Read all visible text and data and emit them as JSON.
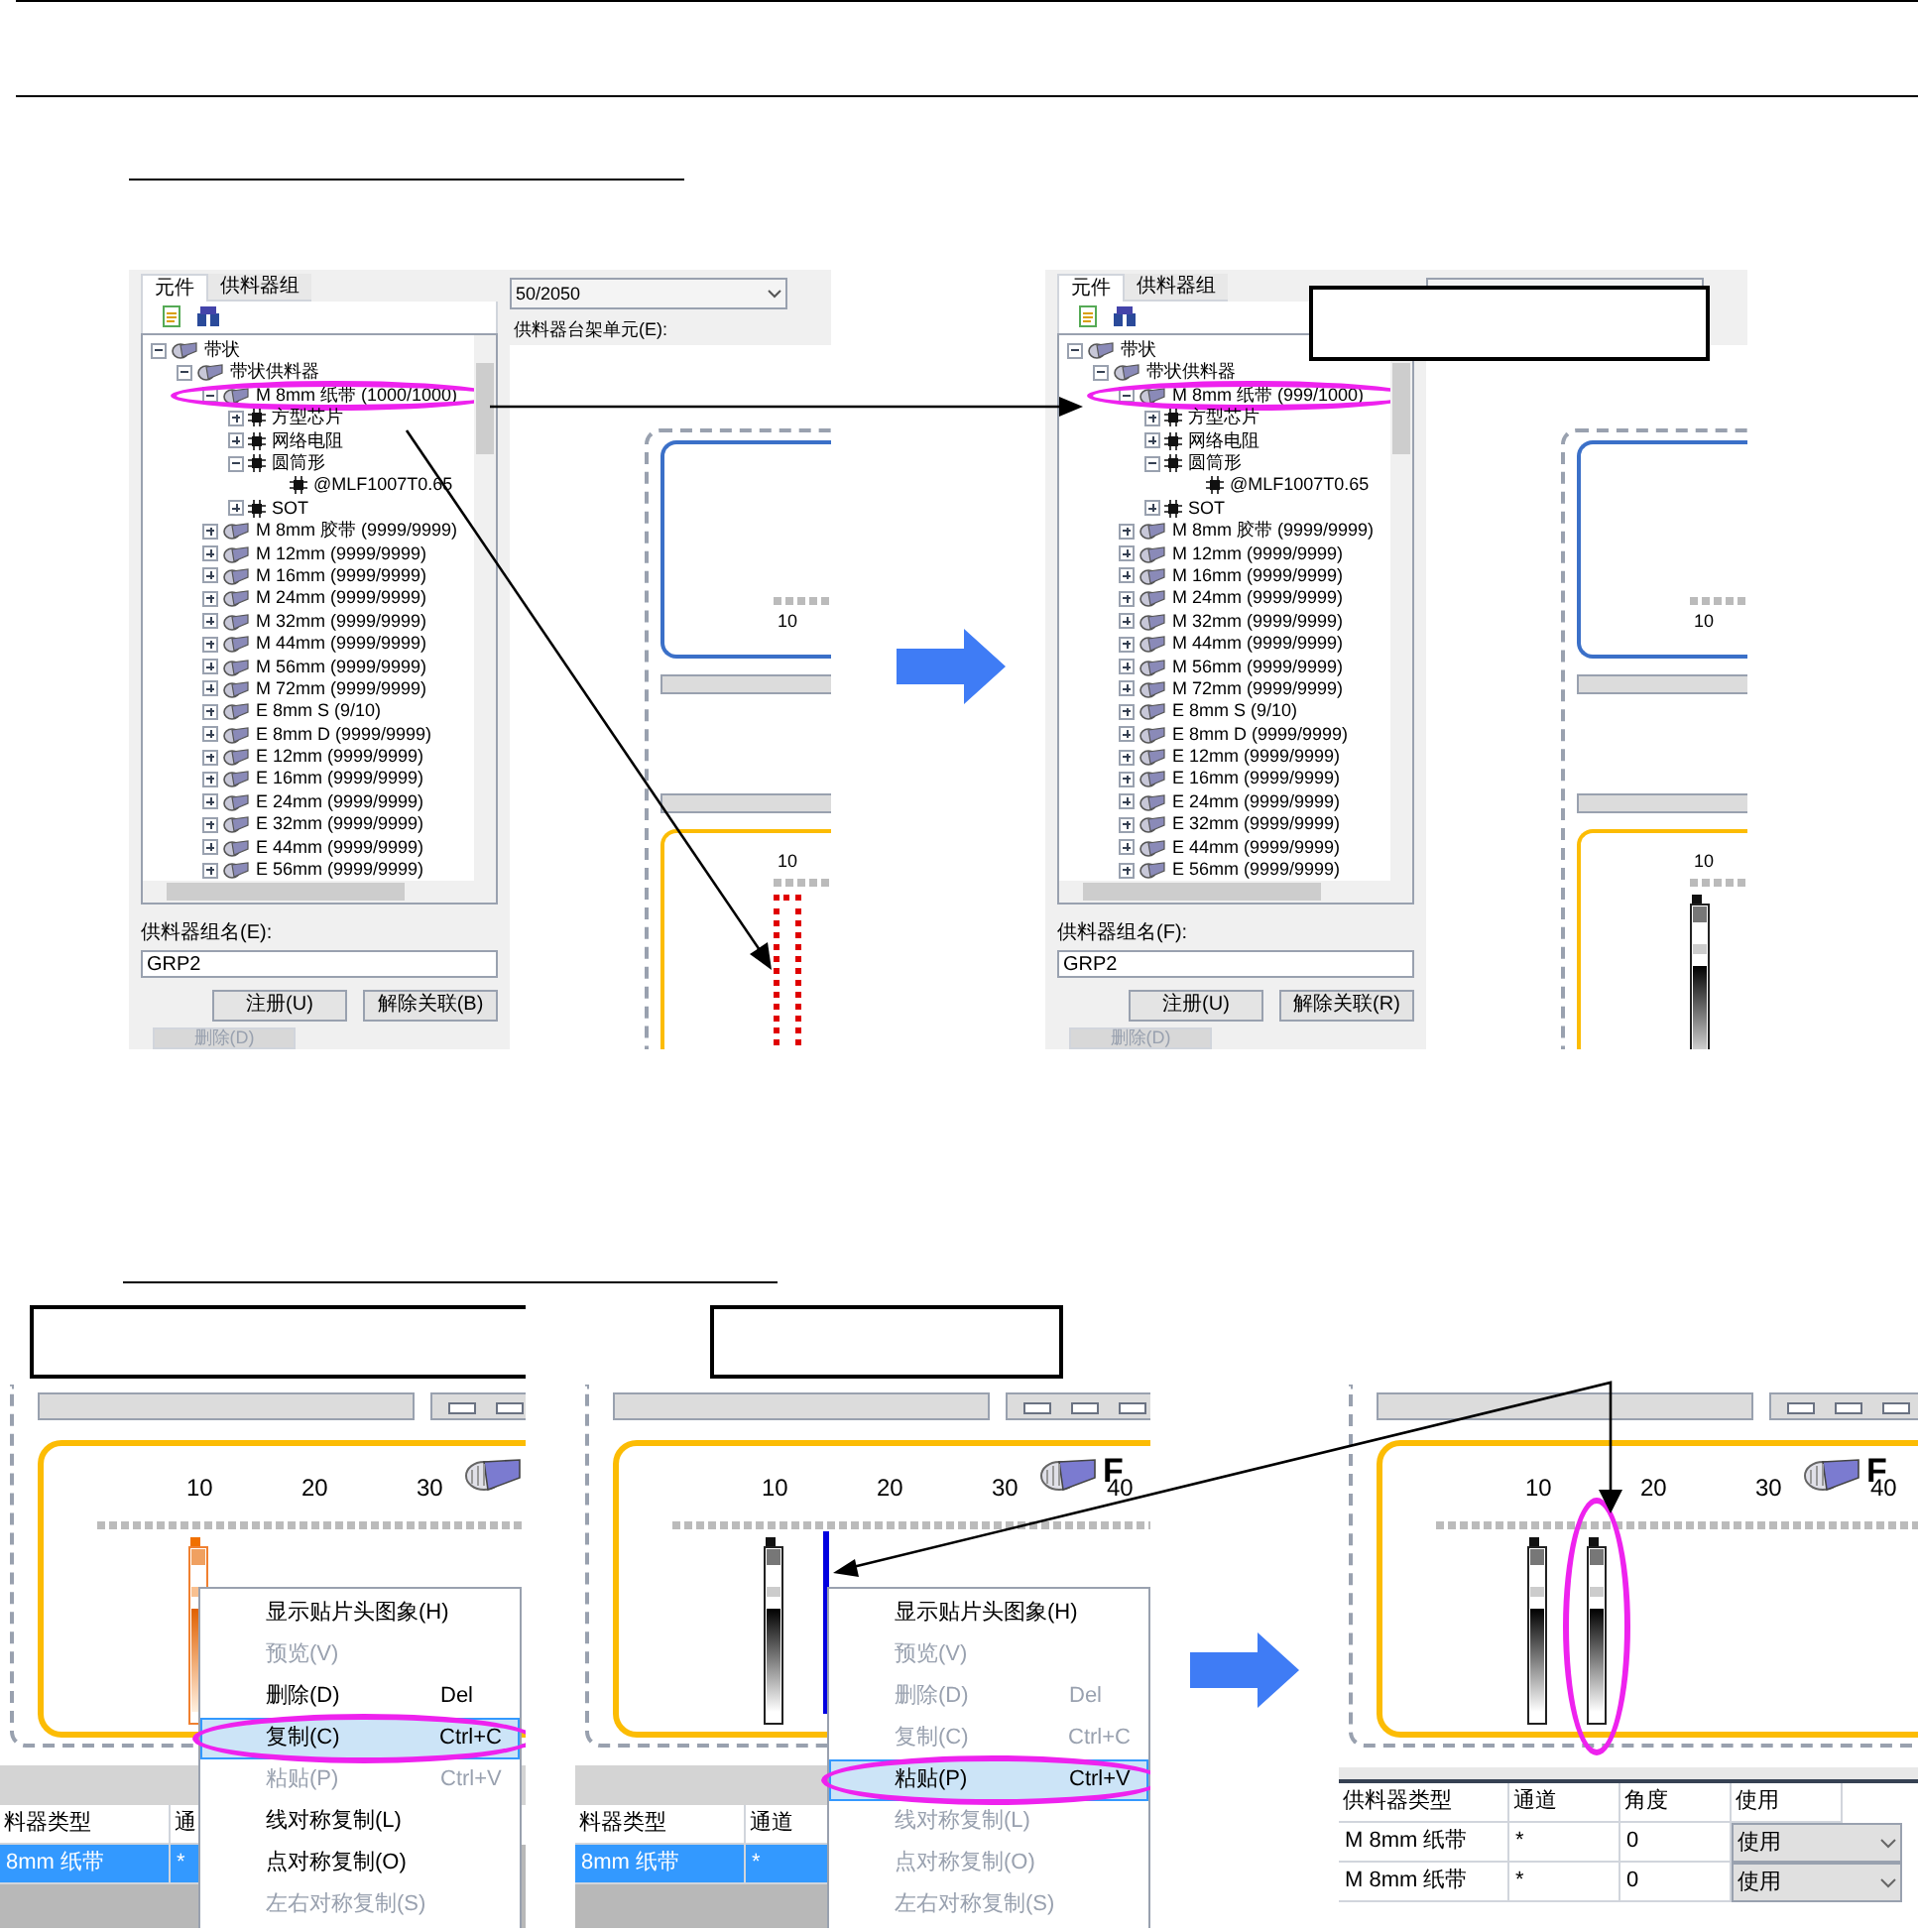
{
  "figure_1": {
    "panels": [
      {
        "tabs": [
          {
            "label": "元件",
            "selected": true
          },
          {
            "label": "供料器组",
            "selected": false
          }
        ],
        "dropdown": "50/2050",
        "rack_label": "供料器台架单元(E):",
        "tree": [
          {
            "label": "带状",
            "kind": "reel",
            "expanded": true,
            "children": [
              {
                "label": "带状供料器",
                "kind": "reel",
                "expanded": true,
                "children": [
                  {
                    "label": "M 8mm 纸带 (1000/1000)",
                    "kind": "reel",
                    "expanded": true,
                    "circled": true,
                    "children": [
                      {
                        "label": "方型芯片",
                        "kind": "chip",
                        "expanded": false
                      },
                      {
                        "label": "网络电阻",
                        "kind": "chip",
                        "expanded": false
                      },
                      {
                        "label": "圆筒形",
                        "kind": "chip",
                        "expanded": true,
                        "children": [
                          {
                            "label": "@MLF1007T0.65",
                            "kind": "chip"
                          }
                        ]
                      },
                      {
                        "label": "SOT",
                        "kind": "chip",
                        "expanded": false
                      }
                    ]
                  },
                  {
                    "label": "M 8mm 胶带 (9999/9999)",
                    "kind": "reel",
                    "expanded": false
                  },
                  {
                    "label": "M 12mm (9999/9999)",
                    "kind": "reel",
                    "expanded": false
                  },
                  {
                    "label": "M 16mm (9999/9999)",
                    "kind": "reel",
                    "expanded": false
                  },
                  {
                    "label": "M 24mm (9999/9999)",
                    "kind": "reel",
                    "expanded": false
                  },
                  {
                    "label": "M 32mm (9999/9999)",
                    "kind": "reel",
                    "expanded": false
                  },
                  {
                    "label": "M 44mm (9999/9999)",
                    "kind": "reel",
                    "expanded": false
                  },
                  {
                    "label": "M 56mm (9999/9999)",
                    "kind": "reel",
                    "expanded": false
                  },
                  {
                    "label": "M 72mm (9999/9999)",
                    "kind": "reel",
                    "expanded": false
                  },
                  {
                    "label": "E 8mm S (9/10)",
                    "kind": "reel",
                    "expanded": false
                  },
                  {
                    "label": "E 8mm D (9999/9999)",
                    "kind": "reel",
                    "expanded": false
                  },
                  {
                    "label": "E 12mm (9999/9999)",
                    "kind": "reel",
                    "expanded": false
                  },
                  {
                    "label": "E 16mm (9999/9999)",
                    "kind": "reel",
                    "expanded": false
                  },
                  {
                    "label": "E 24mm (9999/9999)",
                    "kind": "reel",
                    "expanded": false
                  },
                  {
                    "label": "E 32mm (9999/9999)",
                    "kind": "reel",
                    "expanded": false
                  },
                  {
                    "label": "E 44mm (9999/9999)",
                    "kind": "reel",
                    "expanded": false
                  },
                  {
                    "label": "E 56mm (9999/9999)",
                    "kind": "reel",
                    "expanded": false
                  }
                ]
              }
            ]
          }
        ],
        "group_label": "供料器组名(E):",
        "group_value": "GRP2",
        "buttons": [
          {
            "label": "注册(U)",
            "disabled": false
          },
          {
            "label": "解除关联(B)",
            "disabled": false
          },
          {
            "label": "删除(D)",
            "disabled": true
          }
        ],
        "upper_ruler": [
          "10"
        ],
        "lower_ruler": [
          "10"
        ],
        "slots": [
          {
            "kind": "empty-slot"
          }
        ]
      },
      {
        "tabs": [
          {
            "label": "元件",
            "selected": true
          },
          {
            "label": "供料器组",
            "selected": false
          }
        ],
        "callout": true,
        "tree": [
          {
            "label": "带状",
            "kind": "reel",
            "expanded": true,
            "children": [
              {
                "label": "带状供料器",
                "kind": "reel",
                "expanded": true,
                "children": [
                  {
                    "label": "M 8mm 纸带 (999/1000)",
                    "kind": "reel",
                    "expanded": true,
                    "circled": true,
                    "children": [
                      {
                        "label": "方型芯片",
                        "kind": "chip",
                        "expanded": false
                      },
                      {
                        "label": "网络电阻",
                        "kind": "chip",
                        "expanded": false
                      },
                      {
                        "label": "圆筒形",
                        "kind": "chip",
                        "expanded": true,
                        "children": [
                          {
                            "label": "@MLF1007T0.65",
                            "kind": "chip"
                          }
                        ]
                      },
                      {
                        "label": "SOT",
                        "kind": "chip",
                        "expanded": false
                      }
                    ]
                  },
                  {
                    "label": "M 8mm 胶带 (9999/9999)",
                    "kind": "reel",
                    "expanded": false
                  },
                  {
                    "label": "M 12mm (9999/9999)",
                    "kind": "reel",
                    "expanded": false
                  },
                  {
                    "label": "M 16mm (9999/9999)",
                    "kind": "reel",
                    "expanded": false
                  },
                  {
                    "label": "M 24mm (9999/9999)",
                    "kind": "reel",
                    "expanded": false
                  },
                  {
                    "label": "M 32mm (9999/9999)",
                    "kind": "reel",
                    "expanded": false
                  },
                  {
                    "label": "M 44mm (9999/9999)",
                    "kind": "reel",
                    "expanded": false
                  },
                  {
                    "label": "M 56mm (9999/9999)",
                    "kind": "reel",
                    "expanded": false
                  },
                  {
                    "label": "M 72mm (9999/9999)",
                    "kind": "reel",
                    "expanded": false
                  },
                  {
                    "label": "E 8mm S (9/10)",
                    "kind": "reel",
                    "expanded": false
                  },
                  {
                    "label": "E 8mm D (9999/9999)",
                    "kind": "reel",
                    "expanded": false
                  },
                  {
                    "label": "E 12mm (9999/9999)",
                    "kind": "reel",
                    "expanded": false
                  },
                  {
                    "label": "E 16mm (9999/9999)",
                    "kind": "reel",
                    "expanded": false
                  },
                  {
                    "label": "E 24mm (9999/9999)",
                    "kind": "reel",
                    "expanded": false
                  },
                  {
                    "label": "E 32mm (9999/9999)",
                    "kind": "reel",
                    "expanded": false
                  },
                  {
                    "label": "E 44mm (9999/9999)",
                    "kind": "reel",
                    "expanded": false
                  },
                  {
                    "label": "E 56mm (9999/9999)",
                    "kind": "reel",
                    "expanded": false
                  }
                ]
              }
            ]
          }
        ],
        "group_label": "供料器组名(F):",
        "group_value": "GRP2",
        "buttons": [
          {
            "label": "注册(U)",
            "disabled": false
          },
          {
            "label": "解除关联(R)",
            "disabled": false
          },
          {
            "label": "删除(D)",
            "disabled": true
          }
        ],
        "upper_ruler": [
          "10"
        ],
        "lower_ruler": [
          "10"
        ],
        "slots": [
          {
            "kind": "feeder"
          }
        ]
      }
    ]
  },
  "figure_2": {
    "panels": [
      {
        "callout": true,
        "ruler": [
          "10",
          "20",
          "30"
        ],
        "slots": [
          {
            "kind": "selected-feeder"
          }
        ],
        "menu": [
          {
            "label": "显示贴片头图象(H)",
            "disabled": false,
            "selected": false
          },
          {
            "label": "预览(V)",
            "disabled": true,
            "selected": false
          },
          {
            "label": "删除(D)",
            "shortcut": "Del",
            "disabled": false,
            "selected": false
          },
          {
            "label": "复制(C)",
            "shortcut": "Ctrl+C",
            "disabled": false,
            "selected": true,
            "circled": true
          },
          {
            "label": "粘贴(P)",
            "shortcut": "Ctrl+V",
            "disabled": true,
            "selected": false
          },
          {
            "label": "线对称复制(L)",
            "disabled": false,
            "selected": false
          },
          {
            "label": "点对称复制(O)",
            "disabled": false,
            "selected": false
          },
          {
            "label": "左右对称复制(S)",
            "disabled": true,
            "selected": false
          }
        ],
        "table": {
          "columns": [
            "料器类型",
            "通"
          ],
          "rows": [
            {
              "selected": true,
              "cells": [
                {
                  "kind": "text",
                  "text": "8mm 纸带"
                },
                {
                  "kind": "text",
                  "text": "*"
                }
              ]
            }
          ]
        }
      },
      {
        "callout": true,
        "ruler": [
          "10",
          "20",
          "30",
          "40"
        ],
        "rack_label": "F",
        "slots": [
          {
            "kind": "feeder"
          },
          {
            "kind": "insert-marker"
          }
        ],
        "menu": [
          {
            "label": "显示贴片头图象(H)",
            "disabled": false,
            "selected": false
          },
          {
            "label": "预览(V)",
            "disabled": true,
            "selected": false
          },
          {
            "label": "删除(D)",
            "shortcut": "Del",
            "disabled": true,
            "selected": false
          },
          {
            "label": "复制(C)",
            "shortcut": "Ctrl+C",
            "disabled": true,
            "selected": false
          },
          {
            "label": "粘贴(P)",
            "shortcut": "Ctrl+V",
            "disabled": false,
            "selected": true,
            "circled": true
          },
          {
            "label": "线对称复制(L)",
            "disabled": true,
            "selected": false
          },
          {
            "label": "点对称复制(O)",
            "disabled": true,
            "selected": false
          },
          {
            "label": "左右对称复制(S)",
            "disabled": true,
            "selected": false
          }
        ],
        "table": {
          "columns": [
            "料器类型",
            "通道"
          ],
          "rows": [
            {
              "selected": true,
              "cells": [
                {
                  "kind": "text",
                  "text": "8mm 纸带"
                },
                {
                  "kind": "text",
                  "text": "*"
                }
              ]
            }
          ]
        }
      },
      {
        "ruler": [
          "10",
          "20",
          "30",
          "40"
        ],
        "rack_label": "F",
        "slots": [
          {
            "kind": "feeder"
          },
          {
            "kind": "feeder",
            "circled": true
          }
        ],
        "table": {
          "columns": [
            "供料器类型",
            "通道",
            "角度",
            "使用"
          ],
          "rows": [
            {
              "selected": false,
              "cells": [
                {
                  "kind": "text",
                  "text": "M 8mm 纸带"
                },
                {
                  "kind": "text",
                  "text": "*"
                },
                {
                  "kind": "text",
                  "text": "0"
                },
                {
                  "kind": "select",
                  "text": "使用"
                }
              ]
            },
            {
              "selected": false,
              "cells": [
                {
                  "kind": "text",
                  "text": "M 8mm 纸带"
                },
                {
                  "kind": "text",
                  "text": "*"
                },
                {
                  "kind": "text",
                  "text": "0"
                },
                {
                  "kind": "select",
                  "text": "使用"
                }
              ]
            }
          ]
        }
      }
    ]
  }
}
